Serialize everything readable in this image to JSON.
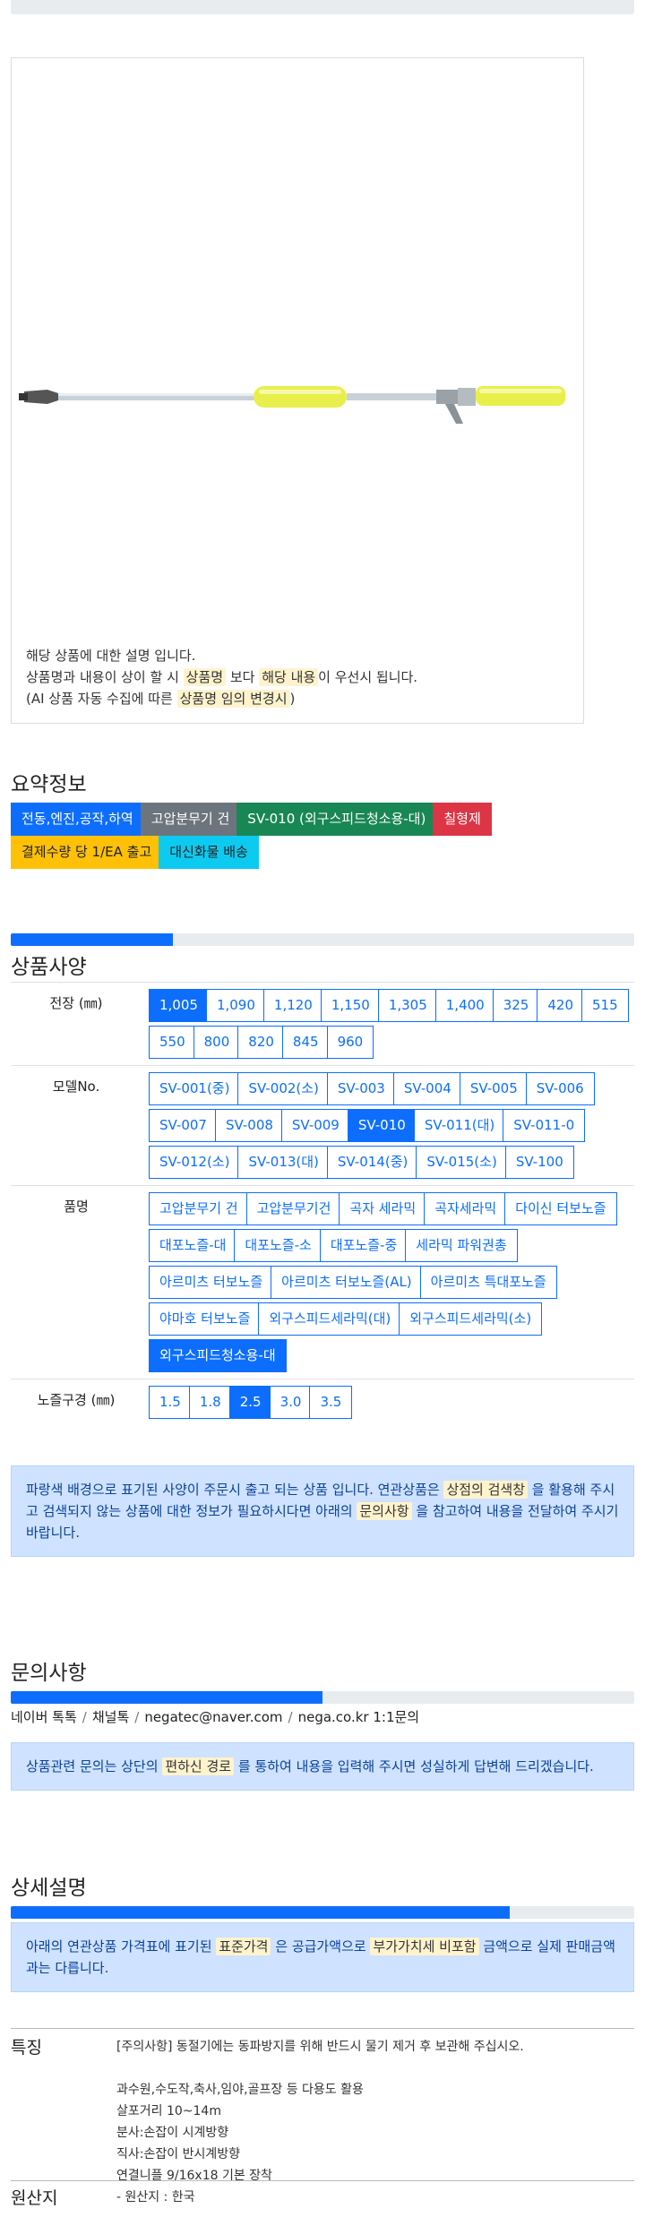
{
  "product_image": {
    "alt": "고압분무기 건 (외구스피드청소용-대)",
    "notice_line1": "해당 상품에 대한 설명 입니다.",
    "notice_line2_a": "상품명과 내용이 상이 할 시 ",
    "notice_line2_b": "상품명",
    "notice_line2_c": " 보다 ",
    "notice_line2_d": "해당 내용",
    "notice_line2_e": "이 우선시 됩니다.",
    "notice_line3_a": "(AI 상품 자동 수집에 따른 ",
    "notice_line3_b": "상품명 임의 변경시",
    "notice_line3_c": ")"
  },
  "summary": {
    "title": "요약정보",
    "badges": [
      "전동,엔진,공작,하역",
      "고압분무기 건",
      "SV-010 (외구스피드청소용-대)",
      "칠형제",
      "결제수량 당 1/EA 출고",
      "대신화물 배송"
    ]
  },
  "spec": {
    "title": "상품사양",
    "progress_fraction": 0.26,
    "rows": [
      {
        "label": "전장 (㎜)",
        "options": [
          "1,005",
          "1,090",
          "1,120",
          "1,150",
          "1,305",
          "1,400",
          "325",
          "420",
          "515",
          "550",
          "800",
          "820",
          "845",
          "960"
        ],
        "selected": "1,005"
      },
      {
        "label": "모델No.",
        "options": [
          "SV-001(중)",
          "SV-002(소)",
          "SV-003",
          "SV-004",
          "SV-005",
          "SV-006",
          "SV-007",
          "SV-008",
          "SV-009",
          "SV-010",
          "SV-011(대)",
          "SV-011-0",
          "SV-012(소)",
          "SV-013(대)",
          "SV-014(중)",
          "SV-015(소)",
          "SV-100"
        ],
        "selected": "SV-010"
      },
      {
        "label": "품명",
        "options": [
          "고압분무기 건",
          "고압분무기건",
          "곡자 세라믹",
          "곡자세라믹",
          "다이신 터보노즐",
          "대포노즐-대",
          "대포노즐-소",
          "대포노즐-중",
          "세라믹 파워권총",
          "아르미츠 터보노즐",
          "아르미츠 터보노즐(AL)",
          "아르미츠 특대포노즐",
          "야마호 터보노즐",
          "외구스피드세라믹(대)",
          "외구스피드세라믹(소)",
          "외구스피드청소용-대"
        ],
        "selected": "외구스피드청소용-대"
      },
      {
        "label": "노즐구경 (㎜)",
        "options": [
          "1.5",
          "1.8",
          "2.5",
          "3.0",
          "3.5"
        ],
        "selected": "2.5"
      }
    ],
    "alert_a": "파랑색 배경으로 표기된 사양이 주문시 출고 되는 상품 입니다. 연관상품은 ",
    "alert_b": "상점의 검색창",
    "alert_c": " 을 활용해 주시고 검색되지 않는 상품에 대한 정보가 필요하시다면 아래의 ",
    "alert_d": "문의사항",
    "alert_e": " 을 참고하여 내용을 전달하여 주시기 바랍니다."
  },
  "inquiry": {
    "title": "문의사항",
    "progress_fraction": 0.5,
    "channels": [
      "네이버 톡톡",
      "채널톡",
      "negatec@naver.com",
      "nega.co.kr 1:1문의"
    ],
    "alert_a": "상품관련 문의는 상단의 ",
    "alert_b": "편하신 경로",
    "alert_c": " 를 통하여 내용을 입력해 주시면 성실하게 답변해 드리겠습니다."
  },
  "detail": {
    "title": "상세설명",
    "progress_fraction": 0.8,
    "alert_a": "아래의 연관상품 가격표에 표기된 ",
    "alert_b": "표준가격",
    "alert_c": " 은 공급가액으로 ",
    "alert_d": "부가가치세 비포함",
    "alert_e": " 금액으로 실제 판매금액과는 다릅니다.",
    "feature_label": "특징",
    "feature_lines": [
      "[주의사항] 동절기에는 동파방지를 위해 반드시 물기 제거 후 보관해 주십시오.",
      "",
      "과수원,수도작,축사,임야,골프장 등 다용도 활용",
      "살포거리 10~14m",
      "분사:손잡이 시계방향",
      "직사:손잡이 반시계방향",
      "연결니플 9/16x18 기본 장착"
    ],
    "origin_label": "원산지",
    "origin_value": "- 원산지 : 한국"
  },
  "colors": {
    "primary": "#0d6efd",
    "handle": "#e9ef4a",
    "alert_bg": "#cfe2ff",
    "highlight": "#fff3cd"
  }
}
